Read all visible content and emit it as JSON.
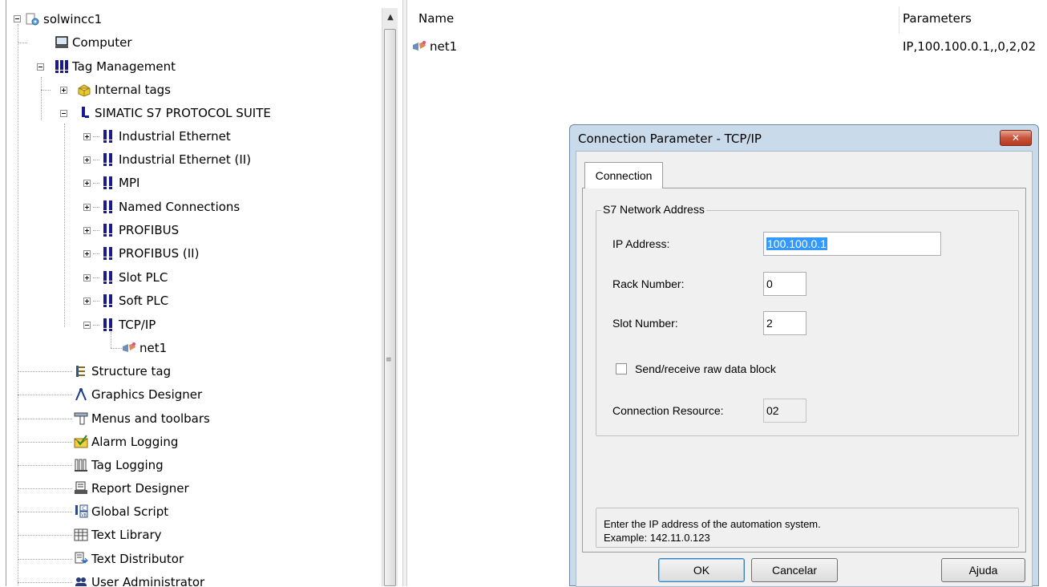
{
  "tree": {
    "items": [
      {
        "label": "solwincc1",
        "icon": "project-icon"
      },
      {
        "label": "Computer",
        "icon": "computer-icon"
      },
      {
        "label": "Tag Management",
        "icon": "tag-management-icon"
      },
      {
        "label": "Internal tags",
        "icon": "internal-tags-icon"
      },
      {
        "label": "SIMATIC S7 PROTOCOL SUITE",
        "icon": "driver-icon"
      },
      {
        "label": "Industrial Ethernet",
        "icon": "channel-icon"
      },
      {
        "label": "Industrial Ethernet (II)",
        "icon": "channel-icon"
      },
      {
        "label": "MPI",
        "icon": "channel-icon"
      },
      {
        "label": "Named Connections",
        "icon": "channel-icon"
      },
      {
        "label": "PROFIBUS",
        "icon": "channel-icon"
      },
      {
        "label": "PROFIBUS (II)",
        "icon": "channel-icon"
      },
      {
        "label": "Slot PLC",
        "icon": "channel-icon"
      },
      {
        "label": "Soft PLC",
        "icon": "channel-icon"
      },
      {
        "label": "TCP/IP",
        "icon": "channel-icon"
      },
      {
        "label": "net1",
        "icon": "connection-icon"
      },
      {
        "label": "Structure tag",
        "icon": "structure-tag-icon"
      },
      {
        "label": "Graphics Designer",
        "icon": "graphics-designer-icon"
      },
      {
        "label": "Menus and toolbars",
        "icon": "menus-toolbars-icon"
      },
      {
        "label": "Alarm Logging",
        "icon": "alarm-logging-icon"
      },
      {
        "label": "Tag Logging",
        "icon": "tag-logging-icon"
      },
      {
        "label": "Report Designer",
        "icon": "report-designer-icon"
      },
      {
        "label": "Global Script",
        "icon": "global-script-icon"
      },
      {
        "label": "Text Library",
        "icon": "text-library-icon"
      },
      {
        "label": "Text Distributor",
        "icon": "text-distributor-icon"
      },
      {
        "label": "User Administrator",
        "icon": "user-administrator-icon"
      }
    ]
  },
  "list": {
    "columns": [
      "Name",
      "Parameters"
    ],
    "rows": [
      {
        "name": "net1",
        "parameters": "IP,100.100.0.1,,0,2,02"
      }
    ]
  },
  "dialog": {
    "title": "Connection Parameter - TCP/IP",
    "close_glyph": "✕",
    "tab": "Connection",
    "group_title": "S7 Network Address",
    "ip_label": "IP Address:",
    "ip_value": "100.100.0.1",
    "rack_label": "Rack Number:",
    "rack_value": "0",
    "slot_label": "Slot Number:",
    "slot_value": "2",
    "raw_checkbox_label": "Send/receive raw data block",
    "raw_checkbox_checked": false,
    "resource_label": "Connection Resource:",
    "resource_value": "02",
    "hint_line1": "Enter the IP address of the automation system.",
    "hint_line2": "Example: 142.11.0.123",
    "ok": "OK",
    "cancel": "Cancelar",
    "help": "Ajuda"
  },
  "scrollbar": {
    "up_glyph": "▲",
    "grip_glyph": "≡"
  }
}
